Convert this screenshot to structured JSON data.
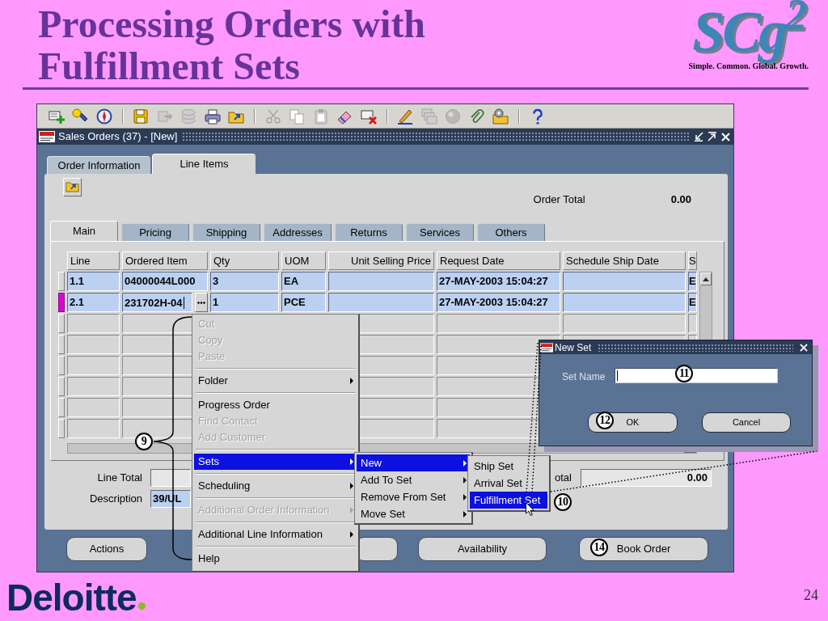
{
  "slide": {
    "title_lines": [
      "Processing Orders with",
      "Fulfillment Sets"
    ],
    "page_number": "24"
  },
  "logo": {
    "wordmark": "SCg$^{2}$",
    "tagline": "Simple. Common. Global. Growth."
  },
  "brand": {
    "name": "Deloitte"
  },
  "toolbar": [
    {
      "kind": "button",
      "disabled": false
    },
    {
      "kind": "button",
      "disabled": false
    },
    {
      "kind": "button",
      "disabled": false
    },
    {
      "kind": "separator"
    },
    {
      "kind": "button",
      "disabled": false
    },
    {
      "kind": "button",
      "disabled": true
    },
    {
      "kind": "button",
      "disabled": true
    },
    {
      "kind": "button",
      "disabled": false
    },
    {
      "kind": "button",
      "disabled": false
    },
    {
      "kind": "separator"
    },
    {
      "kind": "button",
      "disabled": true
    },
    {
      "kind": "button",
      "disabled": true
    },
    {
      "kind": "button",
      "disabled": true
    },
    {
      "kind": "button",
      "disabled": false
    },
    {
      "kind": "button",
      "disabled": false
    },
    {
      "kind": "separator"
    },
    {
      "kind": "button",
      "disabled": false
    },
    {
      "kind": "button",
      "disabled": true
    },
    {
      "kind": "button",
      "disabled": true
    },
    {
      "kind": "button",
      "disabled": false
    },
    {
      "kind": "button",
      "disabled": false
    },
    {
      "kind": "separator"
    },
    {
      "kind": "button",
      "disabled": false
    }
  ],
  "window": {
    "title": "Sales Orders (37) - [New]"
  },
  "tabs": [
    {
      "label": "Order Information",
      "selected": false
    },
    {
      "label": "Line Items",
      "selected": true
    }
  ],
  "order_total": {
    "label": "Order Total",
    "value": "0.00"
  },
  "subtabs": [
    {
      "label": "Main",
      "selected": true
    },
    {
      "label": "Pricing",
      "selected": false
    },
    {
      "label": "Shipping",
      "selected": false
    },
    {
      "label": "Addresses",
      "selected": false
    },
    {
      "label": "Returns",
      "selected": false
    },
    {
      "label": "Services",
      "selected": false
    },
    {
      "label": "Others",
      "selected": false
    }
  ],
  "table": {
    "columns": [
      "Line",
      "Ordered Item",
      "Qty",
      "UOM",
      "Unit Selling Price",
      "Request Date",
      "Schedule Ship Date",
      "S"
    ],
    "rows": [
      {
        "kind": "record",
        "selected": false,
        "focused": false,
        "cells": [
          "1.1",
          "04000044L000",
          "3",
          "EA",
          null,
          "27-MAY-2003 15:04:27",
          null,
          "E"
        ]
      },
      {
        "kind": "record",
        "selected": true,
        "focused": true,
        "cells": [
          "2.1",
          "231702H-04",
          "1",
          "PCE",
          null,
          "27-MAY-2003 15:04:27",
          null,
          "E"
        ]
      },
      {
        "kind": "empty",
        "selected": false,
        "focused": false
      },
      {
        "kind": "empty",
        "selected": false,
        "focused": false
      },
      {
        "kind": "empty",
        "selected": false,
        "focused": false
      },
      {
        "kind": "empty",
        "selected": false,
        "focused": false
      },
      {
        "kind": "empty",
        "selected": false,
        "focused": false
      },
      {
        "kind": "empty",
        "selected": false,
        "focused": false
      }
    ]
  },
  "summary_rows": [
    [
      {
        "label": "Line Total",
        "highlighted": false
      },
      {
        "label": "otal",
        "value": "0.00",
        "highlighted": false
      }
    ],
    [
      {
        "label": "Description",
        "value": "39/UL",
        "highlighted": true
      }
    ]
  ],
  "buttons": [
    {
      "kind": "labeled",
      "label": "Actions"
    },
    {
      "kind": "blank"
    },
    {
      "kind": "labeled",
      "label": "Availability"
    },
    {
      "kind": "labeled",
      "label": "Book Order"
    }
  ],
  "context_menu": {
    "items": [
      {
        "kind": "item",
        "label": "Cut",
        "disabled": true,
        "selected": false,
        "submenu": false
      },
      {
        "kind": "item",
        "label": "Copy",
        "disabled": true,
        "selected": false,
        "submenu": false
      },
      {
        "kind": "item",
        "label": "Paste",
        "disabled": true,
        "selected": false,
        "submenu": false
      },
      {
        "kind": "separator"
      },
      {
        "kind": "item",
        "label": "Folder",
        "disabled": false,
        "selected": false,
        "submenu": true
      },
      {
        "kind": "separator"
      },
      {
        "kind": "item",
        "label": "Progress Order",
        "disabled": false,
        "selected": false,
        "submenu": false
      },
      {
        "kind": "item",
        "label": "Find Contact",
        "disabled": true,
        "selected": false,
        "submenu": false
      },
      {
        "kind": "item",
        "label": "Add Customer",
        "disabled": true,
        "selected": false,
        "submenu": false
      },
      {
        "kind": "separator"
      },
      {
        "kind": "item",
        "label": "Sets",
        "disabled": false,
        "selected": true,
        "submenu": true
      },
      {
        "kind": "separator"
      },
      {
        "kind": "item",
        "label": "Scheduling",
        "disabled": false,
        "selected": false,
        "submenu": true
      },
      {
        "kind": "separator"
      },
      {
        "kind": "item",
        "label": "Additional Order Information",
        "disabled": true,
        "selected": false,
        "submenu": true
      },
      {
        "kind": "separator"
      },
      {
        "kind": "item",
        "label": "Additional Line Information",
        "disabled": false,
        "selected": false,
        "submenu": true
      },
      {
        "kind": "separator"
      },
      {
        "kind": "item",
        "label": "Help",
        "disabled": false,
        "selected": false,
        "submenu": false
      }
    ]
  },
  "sets_submenu": {
    "items": [
      {
        "label": "New",
        "selected": true,
        "submenu": true
      },
      {
        "label": "Add To Set",
        "selected": false,
        "submenu": true
      },
      {
        "label": "Remove From Set",
        "selected": false,
        "submenu": true
      },
      {
        "label": "Move Set",
        "selected": false,
        "submenu": true
      }
    ]
  },
  "new_submenu": {
    "items": [
      {
        "label": "Ship Set",
        "selected": false
      },
      {
        "label": "Arrival Set",
        "selected": false
      },
      {
        "label": "Fulfillment Set",
        "selected": true
      }
    ]
  },
  "dialog": {
    "title": "New Set",
    "field_label": "Set Name",
    "field_focused": true,
    "buttons": [
      "OK",
      "Cancel"
    ]
  },
  "callouts": [
    "9",
    "10",
    "11",
    "12",
    "14"
  ]
}
